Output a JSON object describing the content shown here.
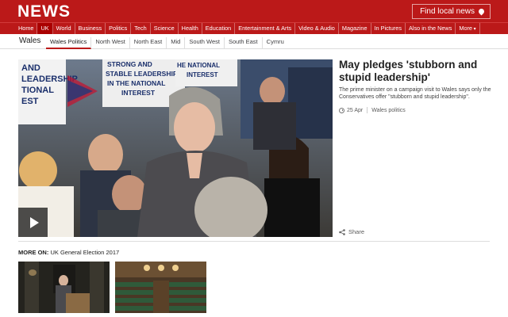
{
  "header": {
    "logo": "NEWS",
    "find_local": "Find local news",
    "nav": [
      "Home",
      "UK",
      "World",
      "Business",
      "Politics",
      "Tech",
      "Science",
      "Health",
      "Education",
      "Entertainment & Arts",
      "Video & Audio",
      "Magazine",
      "In Pictures",
      "Also in the News",
      "More"
    ],
    "active_nav": "UK"
  },
  "subnav": {
    "section": "Wales",
    "items": [
      "Wales Politics",
      "North West",
      "North East",
      "Mid",
      "South West",
      "South East",
      "Cymru"
    ],
    "current": "Wales Politics"
  },
  "story": {
    "headline": "May pledges 'stubborn and stupid leadership'",
    "summary": "The prime minister on a campaign visit to Wales says only the Conservatives offer \"stubborn and stupid leadership\".",
    "date": "25 Apr",
    "tag": "Wales politics",
    "share": "Share",
    "hero_signs": [
      "AND",
      "LEADERSHIP",
      "TIONAL",
      "EST",
      "STRONG AND",
      "STABLE LEADERSHIP",
      "IN THE NATIONAL",
      "INTEREST",
      "HE NATIONAL",
      "INTEREST"
    ]
  },
  "more_on": {
    "label": "MORE ON:",
    "topic": "UK General Election 2017"
  },
  "colors": {
    "brand_red": "#bb1919",
    "text": "#222222"
  }
}
